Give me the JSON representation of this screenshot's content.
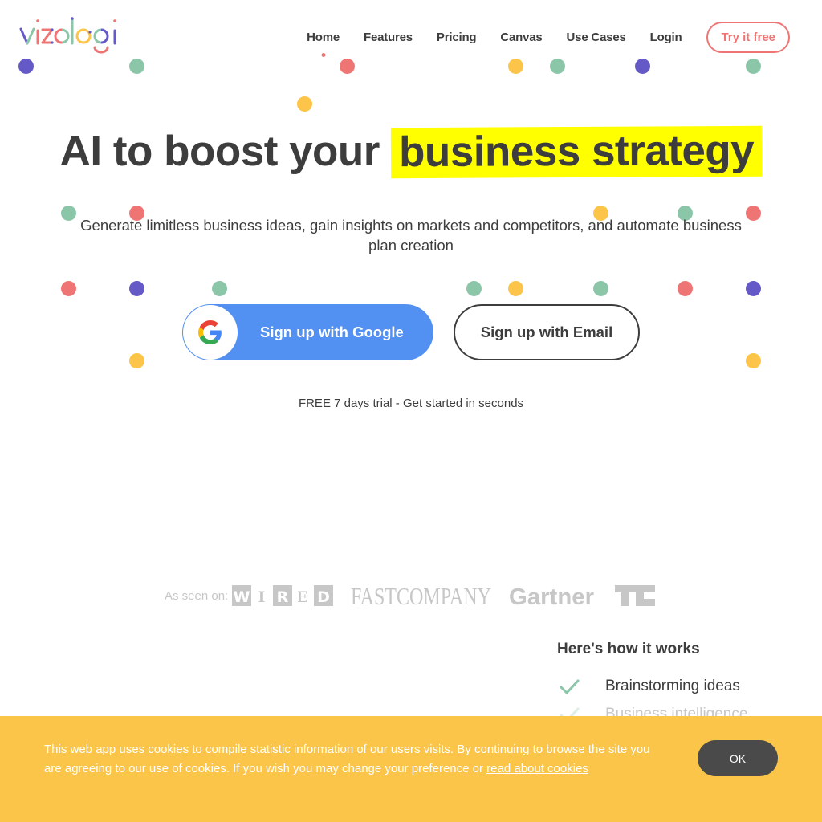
{
  "brand": {
    "name": "vizologi"
  },
  "colors": {
    "text": "#3d3d3d",
    "coral": "#ef7575",
    "green": "#8cc6a9",
    "purple": "#6559c8",
    "yellow": "#fcc54a",
    "highlight": "#ffff00",
    "google_blue": "#5290f2",
    "cookie_bg": "#fbc54a",
    "ok_bg": "#4a4a4a",
    "press_gray": "#c7c7c7"
  },
  "nav": {
    "items": [
      {
        "label": "Home",
        "active": true
      },
      {
        "label": "Features",
        "active": false
      },
      {
        "label": "Pricing",
        "active": false
      },
      {
        "label": "Canvas",
        "active": false
      },
      {
        "label": "Use Cases",
        "active": false
      },
      {
        "label": "Login",
        "active": false
      }
    ],
    "cta_label": "Try it free"
  },
  "hero": {
    "title_prefix": "AI to boost your",
    "title_highlight": "business strategy",
    "subtitle": "Generate limitless business ideas, gain insights on markets and competitors, and automate business plan creation",
    "google_button": {
      "icon": "google-g-icon",
      "label": "Sign up with Google"
    },
    "email_button": {
      "label": "Sign up with Email"
    },
    "trial_note": "FREE 7 days trial - Get started in seconds"
  },
  "press": {
    "label": "As seen on:",
    "logos": [
      "WIRED",
      "FAST COMPANY",
      "Gartner",
      "TechCrunch"
    ]
  },
  "how_it_works": {
    "title": "Here's how it works",
    "items": [
      {
        "icon": "check-icon",
        "label": "Brainstorming ideas"
      },
      {
        "icon": "check-icon",
        "label": "Business intelligence"
      }
    ]
  },
  "cookie_banner": {
    "text": "This web app uses cookies to compile statistic information of our users visits. By continuing to browse the site you are agreeing to our use of cookies. If you wish you may change your preference or",
    "link_label": "read about cookies",
    "ok_label": "OK"
  }
}
